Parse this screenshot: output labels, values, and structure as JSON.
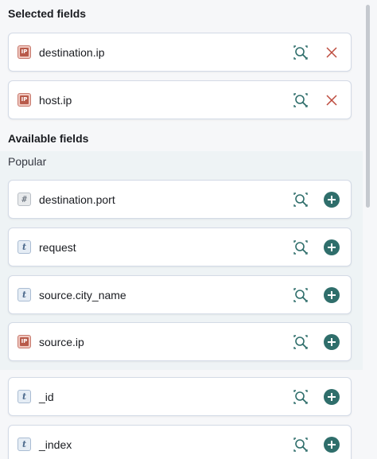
{
  "selected": {
    "title": "Selected fields",
    "fields": [
      {
        "name": "destination.ip",
        "type": "ip",
        "type_label": "IP",
        "action": "remove"
      },
      {
        "name": "host.ip",
        "type": "ip",
        "type_label": "IP",
        "action": "remove"
      }
    ]
  },
  "available": {
    "title": "Available fields",
    "popular_title": "Popular",
    "popular_fields": [
      {
        "name": "destination.port",
        "type": "number",
        "type_label": "#",
        "action": "add"
      },
      {
        "name": "request",
        "type": "string",
        "type_label": "t",
        "action": "add"
      },
      {
        "name": "source.city_name",
        "type": "string",
        "type_label": "t",
        "action": "add"
      },
      {
        "name": "source.ip",
        "type": "ip",
        "type_label": "IP",
        "action": "add"
      }
    ],
    "other_fields": [
      {
        "name": "_id",
        "type": "string",
        "type_label": "t",
        "action": "add"
      },
      {
        "name": "_index",
        "type": "string",
        "type_label": "t",
        "action": "add"
      }
    ]
  },
  "colors": {
    "add_button": "#2f6e6b",
    "remove_icon": "#bd4b3e",
    "inspect_icon": "#2f6e6b"
  },
  "icons": {
    "inspect": "inspect-icon",
    "remove": "cross-icon",
    "add": "plus-circle-icon"
  }
}
